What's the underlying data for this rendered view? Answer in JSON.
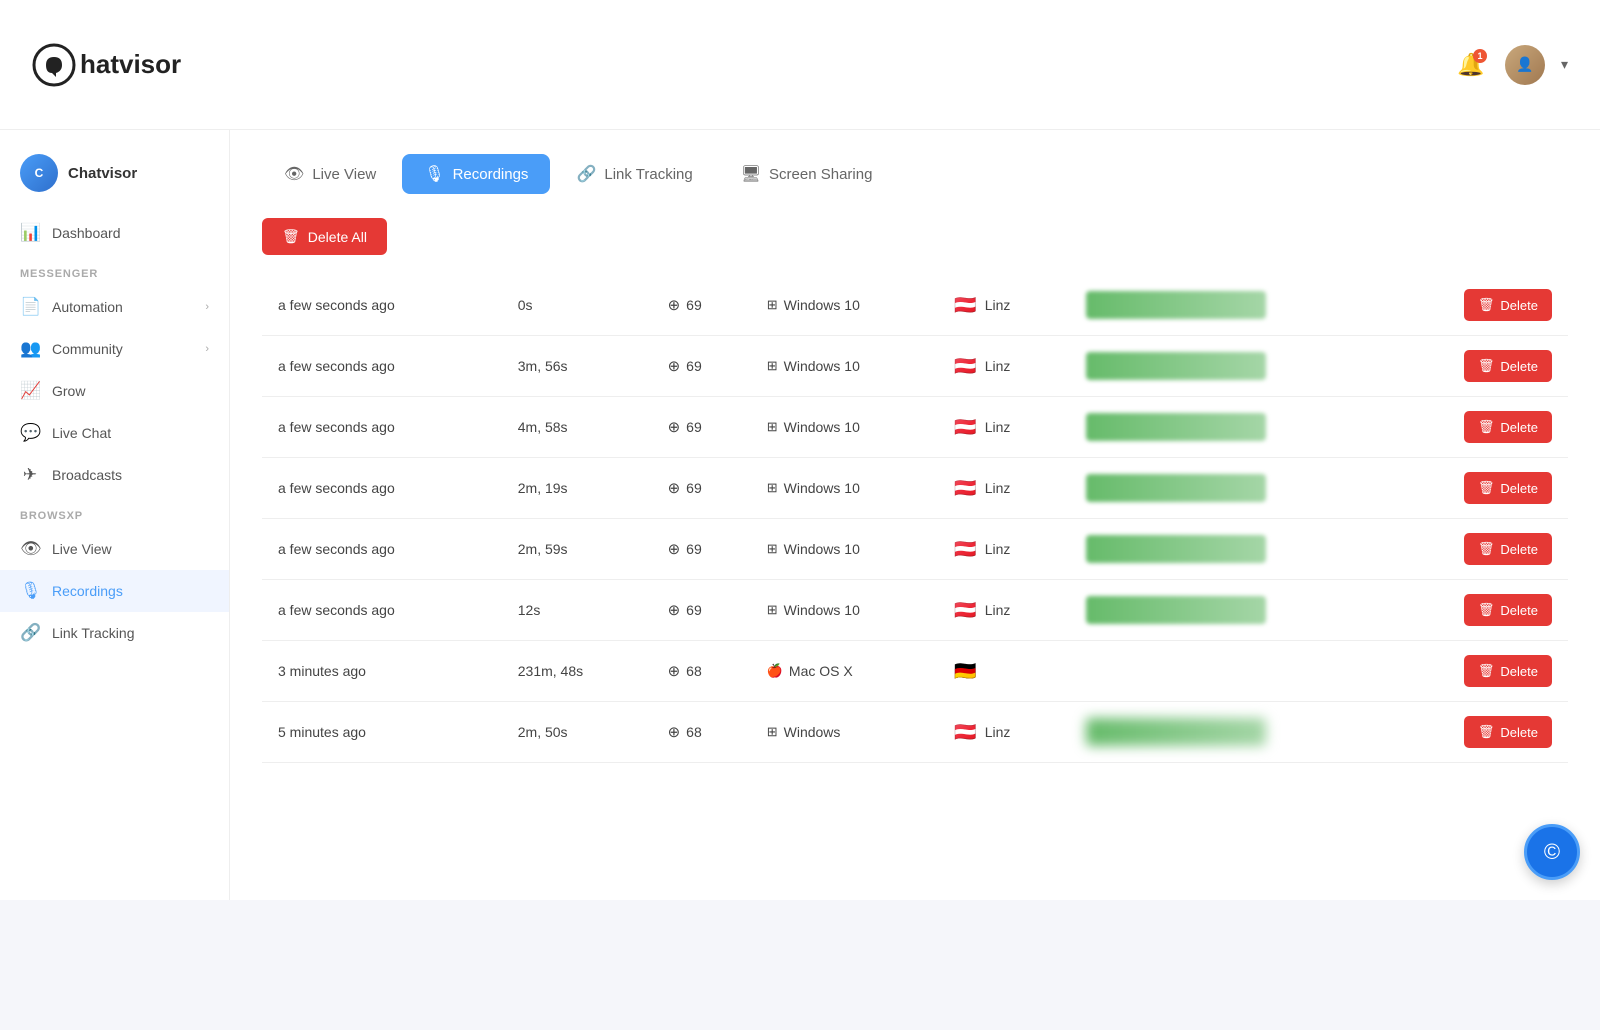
{
  "app": {
    "name": "Chatvisor",
    "logo_text": "hatvisor"
  },
  "header": {
    "notifications_badge": "1",
    "dropdown_arrow": "▾"
  },
  "sidebar": {
    "brand_label": "Chatvisor",
    "sections": [
      {
        "label": "",
        "items": [
          {
            "id": "dashboard",
            "icon": "📊",
            "label": "Dashboard",
            "active": false,
            "has_chevron": false
          }
        ]
      },
      {
        "label": "MESSENGER",
        "items": [
          {
            "id": "automation",
            "icon": "📄",
            "label": "Automation",
            "active": false,
            "has_chevron": true
          },
          {
            "id": "community",
            "icon": "👥",
            "label": "Community",
            "active": false,
            "has_chevron": true
          },
          {
            "id": "grow",
            "icon": "📈",
            "label": "Grow",
            "active": false,
            "has_chevron": false
          },
          {
            "id": "live-chat",
            "icon": "💬",
            "label": "Live Chat",
            "active": false,
            "has_chevron": false
          },
          {
            "id": "broadcasts",
            "icon": "✈",
            "label": "Broadcasts",
            "active": false,
            "has_chevron": false
          }
        ]
      },
      {
        "label": "BROWSXP",
        "items": [
          {
            "id": "live-view",
            "icon": "👁",
            "label": "Live View",
            "active": false,
            "has_chevron": false
          },
          {
            "id": "recordings",
            "icon": "🎙",
            "label": "Recordings",
            "active": true,
            "has_chevron": false
          },
          {
            "id": "link-tracking",
            "icon": "🔗",
            "label": "Link Tracking",
            "active": false,
            "has_chevron": false
          }
        ]
      }
    ]
  },
  "tabs": [
    {
      "id": "live-view",
      "icon": "👁",
      "label": "Live View",
      "active": false
    },
    {
      "id": "recordings",
      "icon": "🎙",
      "label": "Recordings",
      "active": true
    },
    {
      "id": "link-tracking",
      "icon": "🔗",
      "label": "Link Tracking",
      "active": false
    },
    {
      "id": "screen-sharing",
      "icon": "🖥",
      "label": "Screen Sharing",
      "active": false
    }
  ],
  "delete_all_label": "Delete All",
  "recordings": [
    {
      "time": "a few seconds ago",
      "duration": "0s",
      "browser_ver": "69",
      "os": "Windows 10",
      "flag": "🇦🇹",
      "location": "Linz",
      "has_bar": true
    },
    {
      "time": "a few seconds ago",
      "duration": "3m, 56s",
      "browser_ver": "69",
      "os": "Windows 10",
      "flag": "🇦🇹",
      "location": "Linz",
      "has_bar": true
    },
    {
      "time": "a few seconds ago",
      "duration": "4m, 58s",
      "browser_ver": "69",
      "os": "Windows 10",
      "flag": "🇦🇹",
      "location": "Linz",
      "has_bar": true
    },
    {
      "time": "a few seconds ago",
      "duration": "2m, 19s",
      "browser_ver": "69",
      "os": "Windows 10",
      "flag": "🇦🇹",
      "location": "Linz",
      "has_bar": true
    },
    {
      "time": "a few seconds ago",
      "duration": "2m, 59s",
      "browser_ver": "69",
      "os": "Windows 10",
      "flag": "🇦🇹",
      "location": "Linz",
      "has_bar": true
    },
    {
      "time": "a few seconds ago",
      "duration": "12s",
      "browser_ver": "69",
      "os": "Windows 10",
      "flag": "🇦🇹",
      "location": "Linz",
      "has_bar": true
    },
    {
      "time": "3 minutes ago",
      "duration": "231m, 48s",
      "browser_ver": "68",
      "os": "Mac OS X",
      "flag": "🇩🇪",
      "location": "",
      "has_bar": false
    },
    {
      "time": "5 minutes ago",
      "duration": "2m, 50s",
      "browser_ver": "68",
      "os": "Windows",
      "flag": "🇦🇹",
      "location": "Linz",
      "has_bar": true
    }
  ],
  "delete_label": "Delete",
  "colors": {
    "primary": "#4a9df8",
    "danger": "#e53935",
    "green_bar": "#66bb6a"
  }
}
